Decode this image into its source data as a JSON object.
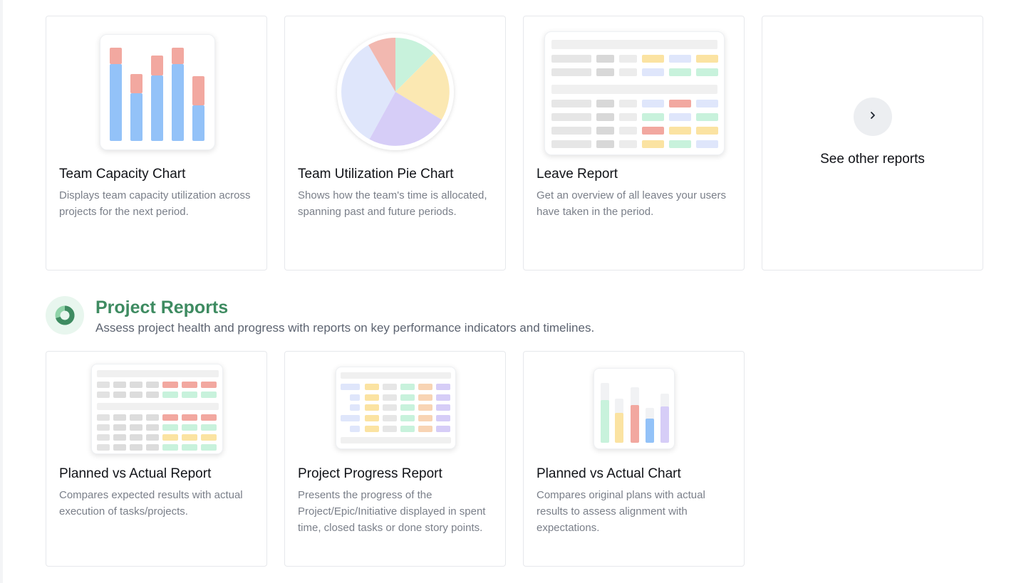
{
  "resource_cards": [
    {
      "title": "Team Capacity Chart",
      "description": "Displays team capacity utilization across projects for the next period."
    },
    {
      "title": "Team Utilization Pie Chart",
      "description": "Shows how the team's time is allocated, spanning past and future periods."
    },
    {
      "title": "Leave Report",
      "description": "Get an overview of all leaves your users have taken in the period."
    }
  ],
  "see_other": {
    "label": "See other reports",
    "icon": "chevron-right-icon"
  },
  "project_section": {
    "title": "Project Reports",
    "subtitle": "Assess project health and progress with reports on key performance indicators and timelines.",
    "icon": "donut-chart-icon",
    "accent_color": "#3e8b61"
  },
  "project_cards": [
    {
      "title": "Planned vs Actual Report",
      "description": "Compares expected results with actual execution of tasks/projects."
    },
    {
      "title": "Project Progress Report",
      "description": "Presents the progress of the Project/Epic/Initiative displayed in spent time, closed tasks or done story points."
    },
    {
      "title": "Planned vs Actual Chart",
      "description": "Compares original plans with actual results to assess alignment with expectations."
    }
  ],
  "colors": {
    "blue": "#93c2f8",
    "red": "#f2a8a0",
    "green": "#c8f2dc",
    "yellow": "#fbe8b2",
    "lavender": "#dfe6fb",
    "purple": "#d6cdf7",
    "gray": "#e6e6e6"
  }
}
